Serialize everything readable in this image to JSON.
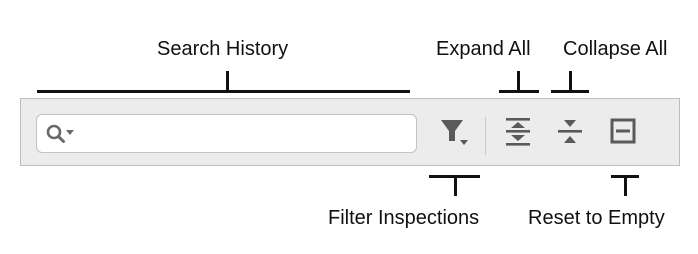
{
  "callouts": {
    "search_history": "Search History",
    "expand_all": "Expand All",
    "collapse_all": "Collapse All",
    "filter_inspections": "Filter Inspections",
    "reset_to_empty": "Reset to Empty"
  },
  "toolbar": {
    "search": {
      "value": "",
      "placeholder": "",
      "icon": "magnifier-dropdown-icon"
    },
    "buttons": [
      {
        "id": "filter",
        "icon": "filter-funnel-icon"
      },
      {
        "id": "expand_all",
        "icon": "expand-all-icon"
      },
      {
        "id": "collapse_all",
        "icon": "collapse-all-icon"
      },
      {
        "id": "reset",
        "icon": "reset-empty-icon"
      }
    ]
  },
  "colors": {
    "toolbar_bg": "#ececec",
    "icon": "#5a5a5a",
    "callout": "#111111"
  }
}
